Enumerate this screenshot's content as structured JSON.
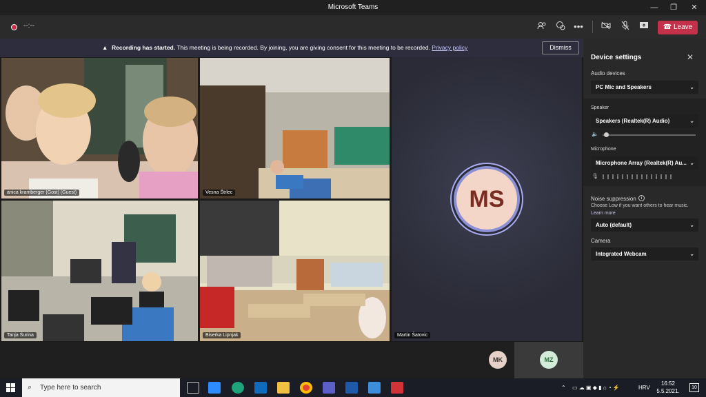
{
  "window": {
    "title": "Microsoft Teams",
    "minimize": "—",
    "restore": "❐",
    "close": "✕"
  },
  "toolbar": {
    "timer": "--:--",
    "leave_label": "Leave"
  },
  "banner": {
    "bold": "Recording has started.",
    "text": " This meeting is being recorded. By joining, you are giving consent for this meeting to be recorded. ",
    "link": "Privacy policy",
    "dismiss": "Dismiss"
  },
  "participants": [
    {
      "name": "anica kramberger (Gost) (Guest)"
    },
    {
      "name": "Vesna Štrlec"
    },
    {
      "name": "Tanja Šurina"
    },
    {
      "name": "Biserka Lipnjak"
    },
    {
      "name": "Martin Šatovic",
      "initials": "MS"
    }
  ],
  "bottom_avatars": [
    {
      "initials": "MK"
    },
    {
      "initials": "MZ"
    }
  ],
  "device_settings": {
    "title": "Device settings",
    "audio_devices_label": "Audio devices",
    "audio_devices_value": "PC Mic and Speakers",
    "speaker_label": "Speaker",
    "speaker_value": "Speakers (Realtek(R) Audio)",
    "microphone_label": "Microphone",
    "microphone_value": "Microphone Array (Realtek(R) Au...",
    "noise_label": "Noise suppression",
    "noise_sub": "Choose Low if you want others to hear music.",
    "learn_more": "Learn more",
    "noise_value": "Auto (default)",
    "camera_label": "Camera",
    "camera_value": "Integrated Webcam"
  },
  "taskbar": {
    "search_placeholder": "Type here to search",
    "language": "HRV",
    "time": "16:52",
    "date": "5.5.2021.",
    "notifications": "10"
  },
  "colors": {
    "leave": "#c4314b",
    "accent": "#8b8fd4",
    "panel": "#292929"
  }
}
